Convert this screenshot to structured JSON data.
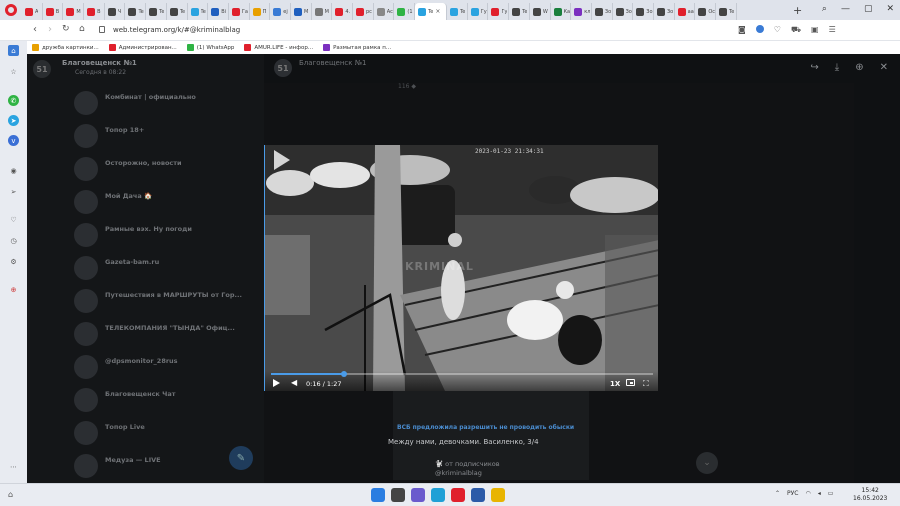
{
  "tabs": [
    {
      "label": "A",
      "color": "#e0202c"
    },
    {
      "label": "В",
      "color": "#e0202c"
    },
    {
      "label": "М",
      "color": "#e0202c"
    },
    {
      "label": "В",
      "color": "#e0202c"
    },
    {
      "label": "Ч",
      "color": "#444444"
    },
    {
      "label": "Te",
      "color": "#444444"
    },
    {
      "label": "Te",
      "color": "#444444"
    },
    {
      "label": "Te",
      "color": "#444444"
    },
    {
      "label": "Te",
      "color": "#2aa3e0"
    },
    {
      "label": "Bi",
      "color": "#1f5fbf"
    },
    {
      "label": "Га",
      "color": "#e0202c"
    },
    {
      "label": "П",
      "color": "#e8a000"
    },
    {
      "label": "еј",
      "color": "#3a7bd5"
    },
    {
      "label": "М",
      "color": "#1f5fbf"
    },
    {
      "label": "М",
      "color": "#777777"
    },
    {
      "label": "4.",
      "color": "#e0202c"
    },
    {
      "label": "рс",
      "color": "#e0202c"
    },
    {
      "label": "Ас",
      "color": "#888888"
    },
    {
      "label": "(1",
      "color": "#2fb344"
    },
    {
      "label": "Te",
      "color": "#2aa3e0",
      "active": true
    },
    {
      "label": "Te",
      "color": "#2aa3e0"
    },
    {
      "label": "Гу",
      "color": "#2aa3e0"
    },
    {
      "label": "Гу",
      "color": "#e0202c"
    },
    {
      "label": "Te",
      "color": "#444444"
    },
    {
      "label": "W",
      "color": "#444444"
    },
    {
      "label": "Ка",
      "color": "#1a7f3c"
    },
    {
      "label": "кл",
      "color": "#7b2fbf"
    },
    {
      "label": "Зо",
      "color": "#444444"
    },
    {
      "label": "Зо",
      "color": "#444444"
    },
    {
      "label": "Зо",
      "color": "#444444"
    },
    {
      "label": "Зо",
      "color": "#444444"
    },
    {
      "label": "аа",
      "color": "#e0202c"
    },
    {
      "label": "Ос",
      "color": "#444444"
    },
    {
      "label": "Te",
      "color": "#444444"
    }
  ],
  "address": {
    "url": "web.telegram.org/k/#@kriminalblag"
  },
  "bookmarks": [
    {
      "label": "дружба картинки...",
      "color": "#e8a000"
    },
    {
      "label": "Администрирован...",
      "color": "#e0202c"
    },
    {
      "label": "(1) WhatsApp",
      "color": "#2fb344"
    },
    {
      "label": "AMUR.LIFE - инфор...",
      "color": "#e0202c"
    },
    {
      "label": "Размытая рамка п...",
      "color": "#7b2fbf"
    }
  ],
  "header": {
    "avatar": "51",
    "title": "Благовещенск №1",
    "subtitle": "Сегодня в 08:22"
  },
  "chats": [
    {
      "name": "Комбинат | официально",
      "msg": "",
      "time": "",
      "badge": ""
    },
    {
      "name": "Топор 18+",
      "msg": "",
      "time": "",
      "badge": ""
    },
    {
      "name": "Осторожно, новости",
      "msg": "",
      "time": "",
      "badge": ""
    },
    {
      "name": "Мой Дача 🏠",
      "msg": "",
      "time": "",
      "badge": ""
    },
    {
      "name": "Рамные вэх. Ну погоди",
      "msg": "",
      "time": "",
      "badge": ""
    },
    {
      "name": "Gazeta-bam.ru",
      "msg": "",
      "time": "",
      "badge": ""
    },
    {
      "name": "Путешествия в МАРШРУТЫ от Гор...",
      "msg": "",
      "time": "",
      "badge": ""
    },
    {
      "name": "ТЕЛЕКОМПАНИЯ \"ТЫНДА\" Офиц...",
      "msg": "",
      "time": "",
      "badge": ""
    },
    {
      "name": "@dpsmonitor_28rus",
      "msg": "",
      "time": "",
      "badge": ""
    },
    {
      "name": "Благовещенск Чат",
      "msg": "",
      "time": "",
      "badge": ""
    },
    {
      "name": "Топор Live",
      "msg": "",
      "time": "",
      "badge": ""
    },
    {
      "name": "Медуза — LIVE",
      "msg": "",
      "time": "",
      "badge": ""
    }
  ],
  "viewer": {
    "avatar": "51",
    "name": "Благовещенск №1",
    "date": "",
    "top_text": "116 ◆"
  },
  "video": {
    "cam_label": "",
    "timestamp": "2023-01-23 21:34:31",
    "watermark": "KRIMINAL",
    "time": "0:16 / 1:27",
    "progress": 0.19,
    "speed": "1X"
  },
  "post": {
    "line1": "ВСБ предложила разрешить не проводить обыски",
    "line2": ""
  },
  "caption": "Между нами, девочками. Василенко, 3/4",
  "subs": "🐩 от подписчиков",
  "channel": "@kriminalblag",
  "taskbar": {
    "lang": "РУС",
    "time": "15:42",
    "date": "16.05.2023"
  }
}
